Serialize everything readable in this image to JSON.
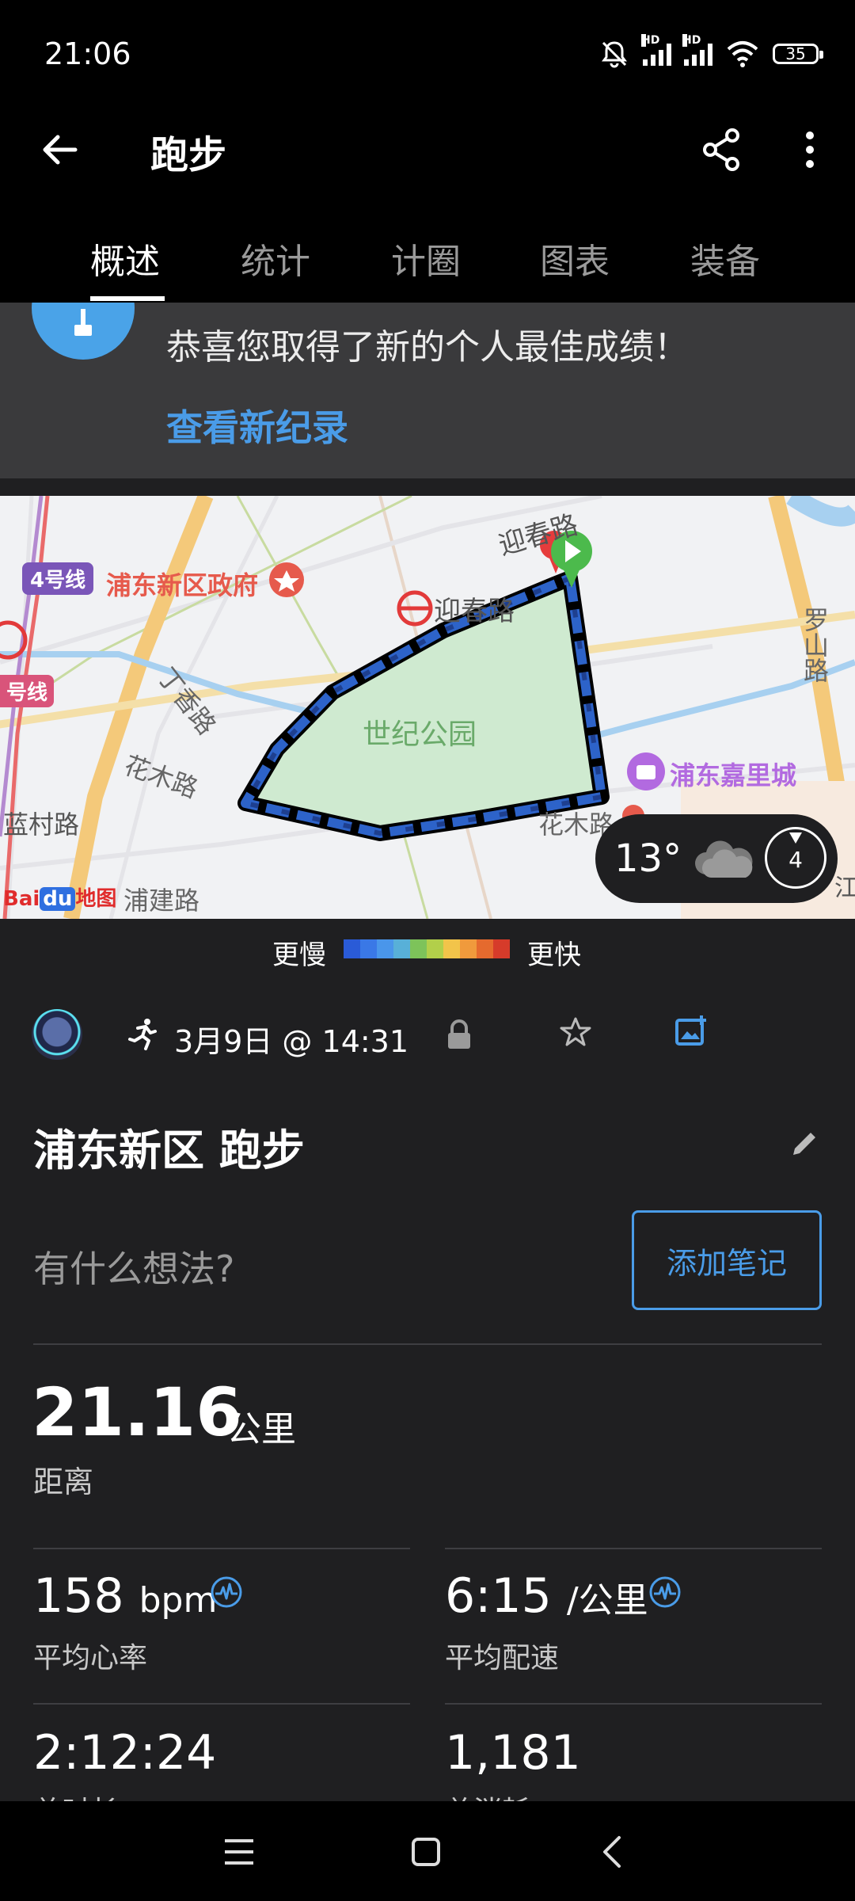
{
  "status_bar": {
    "time": "21:06",
    "battery": "35",
    "network_tag": "HD"
  },
  "app_bar": {
    "title": "跑步",
    "icons": [
      "back-arrow-icon",
      "share-icon",
      "more-vertical-icon"
    ]
  },
  "tabs": [
    {
      "label": "概述",
      "active": true
    },
    {
      "label": "统计",
      "active": false
    },
    {
      "label": "计圈",
      "active": false
    },
    {
      "label": "图表",
      "active": false
    },
    {
      "label": "装备",
      "active": false
    }
  ],
  "banner": {
    "title": "恭喜您取得了新的个人最佳成绩！",
    "link": "查看新纪录"
  },
  "map": {
    "labels": {
      "road_yingchun": "迎春路",
      "yingchun_station": "迎春路",
      "line4": "4号线",
      "pudong_gov": "浦东新区政府",
      "dingxiang": "丁香路",
      "century_park": "世纪公园",
      "luoshan": "罗山路",
      "huamu_left": "花木路",
      "huamu_right": "花木路",
      "line_partial": "号线",
      "pudong_kerry": "浦东嘉里城",
      "lancun": "蓝村路",
      "pujian": "浦建路",
      "baidu_prefix": "Bai",
      "baidu_du": "du",
      "baidu_suffix": "地图",
      "edge_right": "江文"
    },
    "route_colors": [
      "#1e3f8f",
      "#2d63c9",
      "#3a78e0"
    ]
  },
  "weather": {
    "temperature": "13°",
    "wind": "4",
    "condition_icon": "cloud-icon"
  },
  "legend": {
    "slow": "更慢",
    "fast": "更快",
    "colors": [
      "#2a5bd7",
      "#3a78e6",
      "#4a96ea",
      "#58b0d8",
      "#7dc35a",
      "#b2cf4a",
      "#f2c44a",
      "#f09a3c",
      "#e56a2e",
      "#d63b2a"
    ]
  },
  "activity": {
    "date": "3月9日 @ 14:31",
    "title": "浦东新区 跑步",
    "thoughts_placeholder": "有什么想法?",
    "add_note": "添加笔记"
  },
  "stats": {
    "distance": {
      "value": "21.16",
      "unit": "公里",
      "label": "距离"
    },
    "avg_hr": {
      "value": "158",
      "unit": "bpm",
      "label": "平均心率"
    },
    "avg_pace": {
      "value": "6:15",
      "unit": "/公里",
      "label": "平均配速"
    },
    "total_time": {
      "value": "2:12:24",
      "label": "总时长"
    },
    "calories": {
      "value": "1,181",
      "label": "总消耗"
    }
  }
}
